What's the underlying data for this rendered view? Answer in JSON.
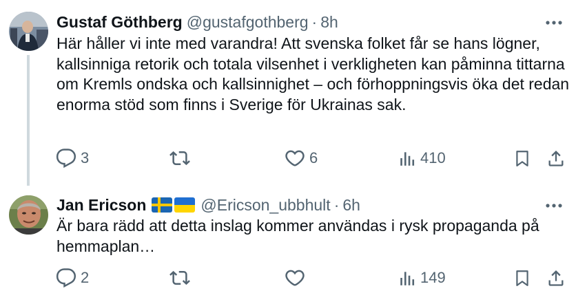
{
  "tweets": [
    {
      "author_name": "Gustaf Göthberg",
      "handle": "@gustafgothberg",
      "separator": "·",
      "time": "8h",
      "text": "Här håller vi inte med varandra! Att svenska folket får se hans lögner, kallsinniga retorik och totala vilsenhet i verkligheten kan påminna tittarna om Kremls ondska och kallsinnighet – och förhoppningsvis öka det redan enorma stöd som finns i Sverige för Ukrainas sak.",
      "replies": "3",
      "retweets": "",
      "likes": "6",
      "views": "410"
    },
    {
      "author_name": "Jan Ericson",
      "handle": "@Ericson_ubbhult",
      "separator": "·",
      "time": "6h",
      "flags": [
        "swedish-flag",
        "ukrainian-flag"
      ],
      "text": "Är bara rädd att detta inslag kommer användas i rysk propaganda på hemmaplan…",
      "replies": "2",
      "retweets": "",
      "likes": "",
      "views": "149"
    }
  ],
  "colors": {
    "text": "#0f1419",
    "secondary": "#536471",
    "thread_line": "#cfd9de",
    "sweden_blue": "#1b66b3",
    "sweden_yellow": "#f7c600",
    "ukraine_blue": "#1f6fd1",
    "ukraine_yellow": "#ffd500"
  },
  "icons": {
    "more": "more-dots-icon",
    "reply": "reply-icon",
    "retweet": "retweet-icon",
    "like": "like-icon",
    "views": "views-icon",
    "bookmark": "bookmark-icon",
    "share": "share-icon"
  }
}
